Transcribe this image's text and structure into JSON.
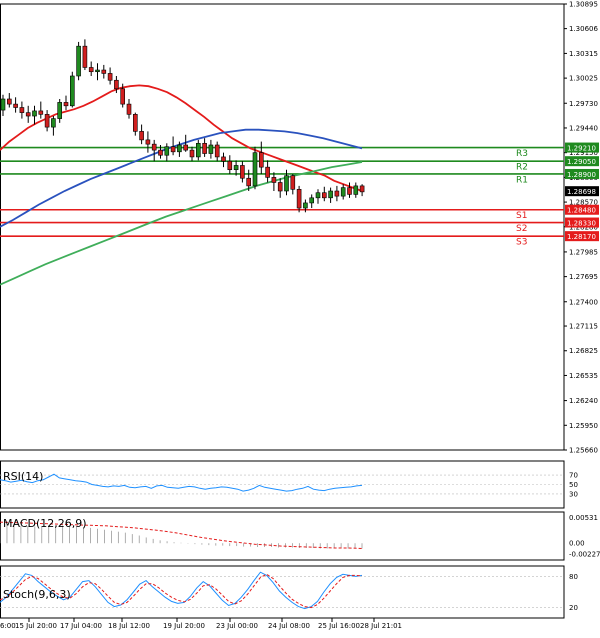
{
  "chart_data": {
    "type": "candlestick",
    "instrument_timeframe": "",
    "price_axis": {
      "ticks": [
        "1.30895",
        "1.30606",
        "1.30315",
        "1.30025",
        "1.29730",
        "1.29440",
        "1.29150",
        "1.28860",
        "1.28570",
        "1.28280",
        "1.27985",
        "1.27695",
        "1.27400",
        "1.27115",
        "1.26825",
        "1.26535",
        "1.26240",
        "1.25950",
        "1.25660"
      ],
      "ylim": [
        1.2566,
        1.30895
      ]
    },
    "time_axis": {
      "labels": [
        "15 Jul 20:00",
        "17 Jul 04:00",
        "18 Jul 12:00",
        "19 Jul 20:00",
        "23 Jul 00:00",
        "24 Jul 08:00",
        "25 Jul 16:00",
        "28 Jul 21:01"
      ],
      "partial_left_label": "6:00"
    },
    "levels": [
      {
        "label": "R3",
        "value": "1.29210",
        "price": 1.2921,
        "color": "#1f8a1f"
      },
      {
        "label": "R2",
        "value": "1.29050",
        "price": 1.2905,
        "color": "#1f8a1f"
      },
      {
        "label": "R1",
        "value": "1.28900",
        "price": 1.289,
        "color": "#1f8a1f"
      },
      {
        "label": "S1",
        "value": "1.28480",
        "price": 1.2848,
        "color": "#e41b1b"
      },
      {
        "label": "S2",
        "value": "1.28330",
        "price": 1.2833,
        "color": "#e41b1b"
      },
      {
        "label": "S3",
        "value": "1.28170",
        "price": 1.2817,
        "color": "#e41b1b"
      }
    ],
    "current_price": {
      "value": "1.28698",
      "price": 1.28698
    },
    "candles": [
      {
        "o": 1.2965,
        "h": 1.2983,
        "l": 1.2958,
        "c": 1.2978
      },
      {
        "o": 1.2978,
        "h": 1.2985,
        "l": 1.2968,
        "c": 1.2972
      },
      {
        "o": 1.2972,
        "h": 1.298,
        "l": 1.2962,
        "c": 1.2968
      },
      {
        "o": 1.2968,
        "h": 1.2975,
        "l": 1.2955,
        "c": 1.2962
      },
      {
        "o": 1.2962,
        "h": 1.297,
        "l": 1.295,
        "c": 1.2958
      },
      {
        "o": 1.2958,
        "h": 1.297,
        "l": 1.2948,
        "c": 1.2964
      },
      {
        "o": 1.2964,
        "h": 1.2975,
        "l": 1.2955,
        "c": 1.296
      },
      {
        "o": 1.296,
        "h": 1.2965,
        "l": 1.294,
        "c": 1.2945
      },
      {
        "o": 1.2945,
        "h": 1.2958,
        "l": 1.2935,
        "c": 1.2955
      },
      {
        "o": 1.2955,
        "h": 1.2978,
        "l": 1.295,
        "c": 1.2974
      },
      {
        "o": 1.2974,
        "h": 1.2982,
        "l": 1.2965,
        "c": 1.297
      },
      {
        "o": 1.297,
        "h": 1.301,
        "l": 1.2968,
        "c": 1.3005
      },
      {
        "o": 1.3005,
        "h": 1.3045,
        "l": 1.3,
        "c": 1.304
      },
      {
        "o": 1.304,
        "h": 1.3048,
        "l": 1.3012,
        "c": 1.3015
      },
      {
        "o": 1.3015,
        "h": 1.3022,
        "l": 1.3005,
        "c": 1.301
      },
      {
        "o": 1.301,
        "h": 1.302,
        "l": 1.3,
        "c": 1.3012
      },
      {
        "o": 1.3012,
        "h": 1.3018,
        "l": 1.3002,
        "c": 1.3008
      },
      {
        "o": 1.3008,
        "h": 1.3015,
        "l": 1.2995,
        "c": 1.3
      },
      {
        "o": 1.3,
        "h": 1.3005,
        "l": 1.2985,
        "c": 1.299
      },
      {
        "o": 1.299,
        "h": 1.2996,
        "l": 1.2968,
        "c": 1.2972
      },
      {
        "o": 1.2972,
        "h": 1.2978,
        "l": 1.2955,
        "c": 1.296
      },
      {
        "o": 1.296,
        "h": 1.2962,
        "l": 1.2935,
        "c": 1.294
      },
      {
        "o": 1.294,
        "h": 1.2948,
        "l": 1.2925,
        "c": 1.293
      },
      {
        "o": 1.293,
        "h": 1.294,
        "l": 1.2915,
        "c": 1.2925
      },
      {
        "o": 1.2925,
        "h": 1.293,
        "l": 1.2905,
        "c": 1.2918
      },
      {
        "o": 1.2918,
        "h": 1.2924,
        "l": 1.2908,
        "c": 1.2912
      },
      {
        "o": 1.2912,
        "h": 1.2926,
        "l": 1.2905,
        "c": 1.2922
      },
      {
        "o": 1.2922,
        "h": 1.2934,
        "l": 1.2912,
        "c": 1.2916
      },
      {
        "o": 1.2916,
        "h": 1.2928,
        "l": 1.291,
        "c": 1.2924
      },
      {
        "o": 1.2924,
        "h": 1.2936,
        "l": 1.2916,
        "c": 1.2918
      },
      {
        "o": 1.2918,
        "h": 1.2922,
        "l": 1.2905,
        "c": 1.291
      },
      {
        "o": 1.291,
        "h": 1.293,
        "l": 1.2906,
        "c": 1.2926
      },
      {
        "o": 1.2926,
        "h": 1.2932,
        "l": 1.291,
        "c": 1.2914
      },
      {
        "o": 1.2914,
        "h": 1.293,
        "l": 1.2908,
        "c": 1.2924
      },
      {
        "o": 1.2924,
        "h": 1.2928,
        "l": 1.2905,
        "c": 1.291
      },
      {
        "o": 1.291,
        "h": 1.2915,
        "l": 1.2898,
        "c": 1.2905
      },
      {
        "o": 1.2905,
        "h": 1.2912,
        "l": 1.289,
        "c": 1.2895
      },
      {
        "o": 1.2895,
        "h": 1.2906,
        "l": 1.2888,
        "c": 1.29
      },
      {
        "o": 1.29,
        "h": 1.2905,
        "l": 1.288,
        "c": 1.2885
      },
      {
        "o": 1.2885,
        "h": 1.2895,
        "l": 1.287,
        "c": 1.2876
      },
      {
        "o": 1.2876,
        "h": 1.2922,
        "l": 1.2872,
        "c": 1.2915
      },
      {
        "o": 1.2915,
        "h": 1.2928,
        "l": 1.289,
        "c": 1.2898
      },
      {
        "o": 1.2898,
        "h": 1.2906,
        "l": 1.288,
        "c": 1.2886
      },
      {
        "o": 1.2886,
        "h": 1.2892,
        "l": 1.287,
        "c": 1.288
      },
      {
        "o": 1.288,
        "h": 1.2885,
        "l": 1.2862,
        "c": 1.287
      },
      {
        "o": 1.287,
        "h": 1.2895,
        "l": 1.2865,
        "c": 1.2888
      },
      {
        "o": 1.2888,
        "h": 1.289,
        "l": 1.2866,
        "c": 1.2872
      },
      {
        "o": 1.2872,
        "h": 1.2876,
        "l": 1.2845,
        "c": 1.285
      },
      {
        "o": 1.285,
        "h": 1.286,
        "l": 1.2845,
        "c": 1.2856
      },
      {
        "o": 1.2856,
        "h": 1.2866,
        "l": 1.285,
        "c": 1.2862
      },
      {
        "o": 1.2862,
        "h": 1.2872,
        "l": 1.2855,
        "c": 1.2868
      },
      {
        "o": 1.2868,
        "h": 1.2875,
        "l": 1.2858,
        "c": 1.2862
      },
      {
        "o": 1.2862,
        "h": 1.2874,
        "l": 1.2856,
        "c": 1.287
      },
      {
        "o": 1.287,
        "h": 1.2876,
        "l": 1.2858,
        "c": 1.2864
      },
      {
        "o": 1.2864,
        "h": 1.2878,
        "l": 1.286,
        "c": 1.2874
      },
      {
        "o": 1.2874,
        "h": 1.288,
        "l": 1.2862,
        "c": 1.2866
      },
      {
        "o": 1.2866,
        "h": 1.288,
        "l": 1.2862,
        "c": 1.2876
      },
      {
        "o": 1.2876,
        "h": 1.2878,
        "l": 1.2864,
        "c": 1.2869
      }
    ],
    "moving_averages": [
      {
        "color": "#e41b1b",
        "values": [
          1.2918,
          1.2928,
          1.2936,
          1.2944,
          1.295,
          1.2955,
          1.296,
          1.2963,
          1.2966,
          1.297,
          1.2975,
          1.2981,
          1.2987,
          1.2991,
          1.2993,
          1.2994,
          1.2993,
          1.299,
          1.2986,
          1.298,
          1.2973,
          1.2965,
          1.2957,
          1.2948,
          1.294,
          1.2932,
          1.2926,
          1.292,
          1.2916,
          1.2912,
          1.2908,
          1.2904,
          1.29,
          1.2896,
          1.2892,
          1.2888,
          1.2882,
          1.2878,
          1.2874,
          1.287
        ]
      },
      {
        "color": "#2a52be",
        "values": [
          1.2828,
          1.2836,
          1.2845,
          1.2854,
          1.2862,
          1.287,
          1.2877,
          1.2884,
          1.289,
          1.2896,
          1.2902,
          1.2908,
          1.2914,
          1.292,
          1.2925,
          1.293,
          1.2934,
          1.2938,
          1.294,
          1.2942,
          1.2942,
          1.2941,
          1.294,
          1.2938,
          1.2935,
          1.2932,
          1.2928,
          1.2924,
          1.292
        ]
      },
      {
        "color": "#3fae5a",
        "values": [
          1.276,
          1.2768,
          1.2776,
          1.2784,
          1.2791,
          1.2798,
          1.2805,
          1.2812,
          1.2819,
          1.2826,
          1.2833,
          1.284,
          1.2846,
          1.2852,
          1.2858,
          1.2864,
          1.287,
          1.2876,
          1.2881,
          1.2886,
          1.289,
          1.2894,
          1.2898,
          1.2901,
          1.2904
        ]
      }
    ],
    "rsi": {
      "label": "RSI(14)",
      "ticks": [
        "70",
        "50",
        "30"
      ],
      "ylim": [
        0,
        100
      ],
      "values": [
        60,
        58,
        55,
        57,
        59,
        56,
        54,
        58,
        60,
        66,
        72,
        64,
        62,
        60,
        58,
        57,
        55,
        50,
        48,
        46,
        45,
        47,
        46,
        48,
        44,
        43,
        45,
        46,
        42,
        47,
        48,
        44,
        43,
        42,
        44,
        46,
        45,
        42,
        40,
        42,
        43,
        45,
        44,
        42,
        40,
        36,
        38,
        42,
        48,
        44,
        42,
        40,
        38,
        36,
        37,
        40,
        42,
        46,
        40,
        38,
        37,
        40,
        42,
        43,
        44,
        45,
        47,
        48
      ]
    },
    "macd": {
      "label": "MACD(12,26,9)",
      "ticks": [
        "0.00531",
        "0.00",
        "-0.002275"
      ],
      "ylim": [
        -0.0035,
        0.0065
      ],
      "hist": [
        0.004,
        0.004,
        0.0038,
        0.0036,
        0.0036,
        0.0035,
        0.0035,
        0.0036,
        0.0037,
        0.0037,
        0.0036,
        0.0035,
        0.0034,
        0.0032,
        0.003,
        0.0028,
        0.0026,
        0.0024,
        0.0022,
        0.0019,
        0.0016,
        0.0012,
        0.0009,
        0.0006,
        0.0004,
        0.0002,
        0.0001,
        -0.0001,
        -0.0002,
        -0.0003,
        -0.0004,
        -0.0005,
        -0.0005,
        -0.0006,
        -0.0006,
        -0.0007,
        -0.0007,
        -0.0008,
        -0.0008,
        -0.0008,
        -0.0009,
        -0.0009,
        -0.0009,
        -0.001,
        -0.001,
        -0.001,
        -0.0011,
        -0.0011,
        -0.0011,
        -0.0011,
        -0.0011,
        -0.0011,
        -0.0011
      ],
      "signal": [
        0.0044,
        0.0043,
        0.0042,
        0.0041,
        0.004,
        0.0039,
        0.0038,
        0.0037,
        0.0036,
        0.0034,
        0.0032,
        0.0029,
        0.0026,
        0.0022,
        0.0017,
        0.0012,
        0.0008,
        0.0004,
        0.0001,
        -0.0002,
        -0.0004,
        -0.0006,
        -0.0007,
        -0.0008,
        -0.0009,
        -0.001,
        -0.001,
        -0.0011
      ]
    },
    "stoch": {
      "label": "Stoch(9,6,3)",
      "ticks": [
        "80",
        "20"
      ],
      "ylim": [
        0,
        100
      ],
      "main": [
        30,
        40,
        55,
        70,
        85,
        82,
        70,
        60,
        50,
        42,
        35,
        40,
        55,
        70,
        72,
        60,
        45,
        30,
        22,
        25,
        35,
        50,
        65,
        72,
        60,
        50,
        40,
        32,
        28,
        30,
        42,
        58,
        70,
        62,
        48,
        34,
        24,
        28,
        40,
        55,
        72,
        88,
        82,
        68,
        52,
        40,
        30,
        22,
        18,
        22,
        32,
        50,
        66,
        78,
        84,
        82,
        80,
        82
      ],
      "signal": [
        35,
        40,
        50,
        62,
        74,
        80,
        76,
        66,
        56,
        47,
        40,
        38,
        47,
        60,
        68,
        66,
        55,
        42,
        30,
        26,
        30,
        42,
        55,
        66,
        66,
        58,
        48,
        40,
        34,
        31,
        36,
        48,
        62,
        64,
        56,
        44,
        32,
        27,
        33,
        46,
        62,
        78,
        84,
        76,
        62,
        48,
        36,
        28,
        22,
        20,
        26,
        38,
        52,
        66,
        78,
        82,
        82,
        81
      ]
    }
  }
}
